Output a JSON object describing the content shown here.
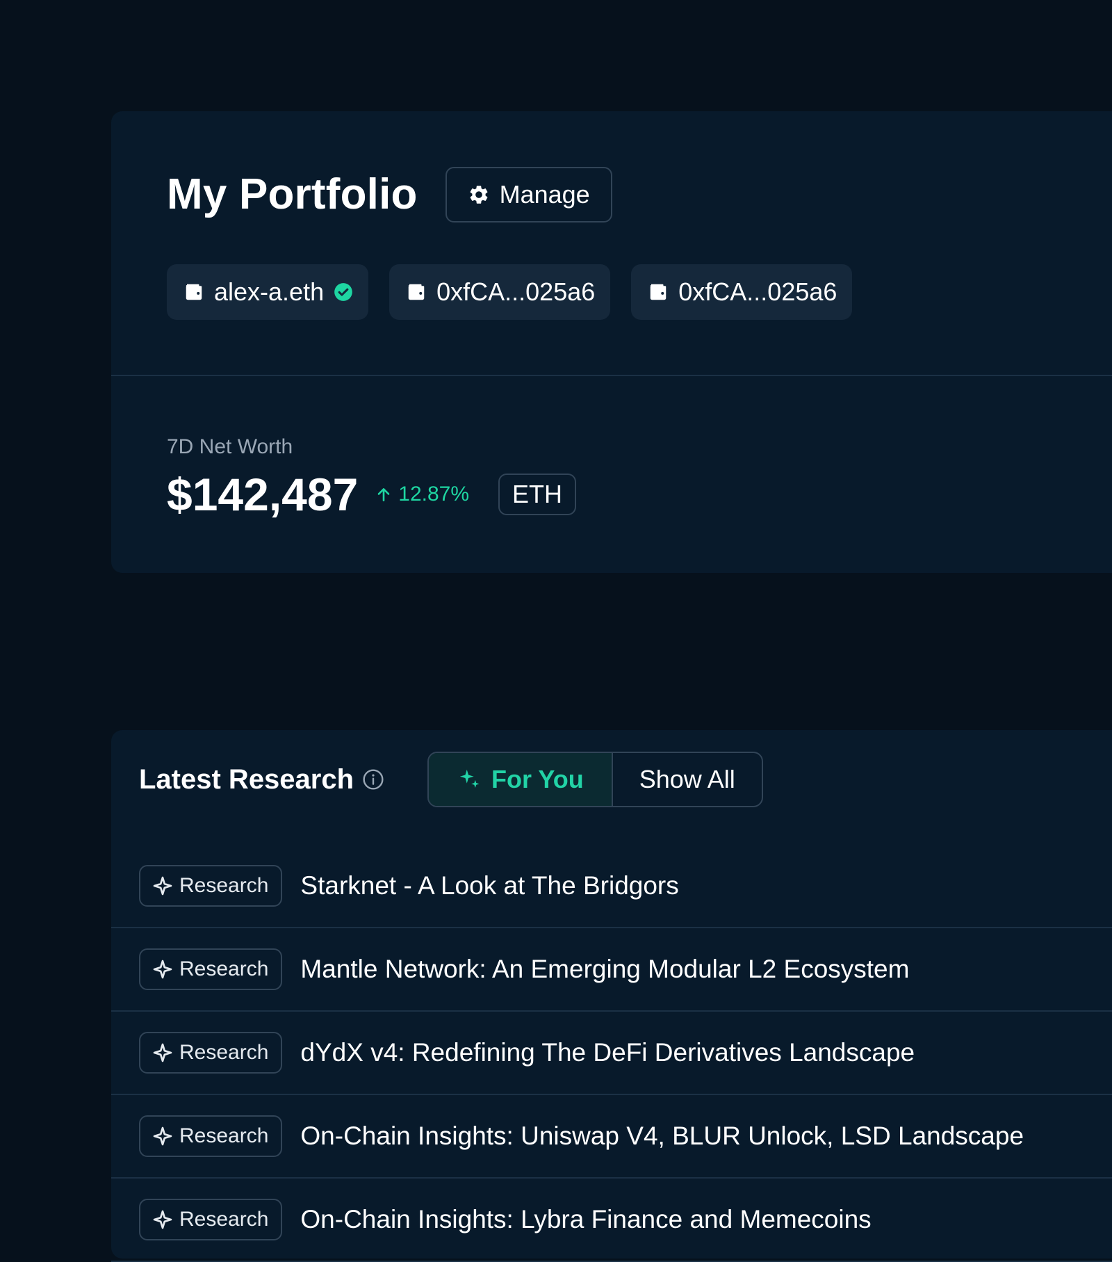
{
  "portfolio": {
    "title": "My Portfolio",
    "manage_label": "Manage",
    "wallets": [
      {
        "label": "alex-a.eth",
        "verified": true
      },
      {
        "label": "0xfCA...025a6",
        "verified": false
      },
      {
        "label": "0xfCA...025a6",
        "verified": false
      }
    ],
    "net_worth": {
      "label": "7D Net Worth",
      "value": "$142,487",
      "change": "12.87%",
      "currency": "ETH"
    }
  },
  "research": {
    "title": "Latest Research",
    "tabs": [
      {
        "label": "For You",
        "active": true
      },
      {
        "label": "Show All",
        "active": false
      }
    ],
    "items": [
      {
        "tag": "Research",
        "title": "Starknet - A Look at The Bridgors"
      },
      {
        "tag": "Research",
        "title": "Mantle Network: An Emerging Modular L2 Ecosystem"
      },
      {
        "tag": "Research",
        "title": "dYdX v4: Redefining The DeFi Derivatives Landscape"
      },
      {
        "tag": "Research",
        "title": "On-Chain Insights: Uniswap V4, BLUR Unlock, LSD Landscape"
      },
      {
        "tag": "Research",
        "title": "On-Chain Insights: Lybra Finance and Memecoins"
      }
    ]
  },
  "colors": {
    "background": "#06111c",
    "panel": "#081a2b",
    "accent": "#22d3a6",
    "positive": "#1ed6a2",
    "border": "#314457"
  },
  "icons": {
    "manage": "gear-icon",
    "wallet": "wallet-icon",
    "verified": "check-circle-icon",
    "change": "arrow-up-icon",
    "info": "info-icon",
    "for_you": "sparkles-icon",
    "tag": "sparkle-icon"
  }
}
